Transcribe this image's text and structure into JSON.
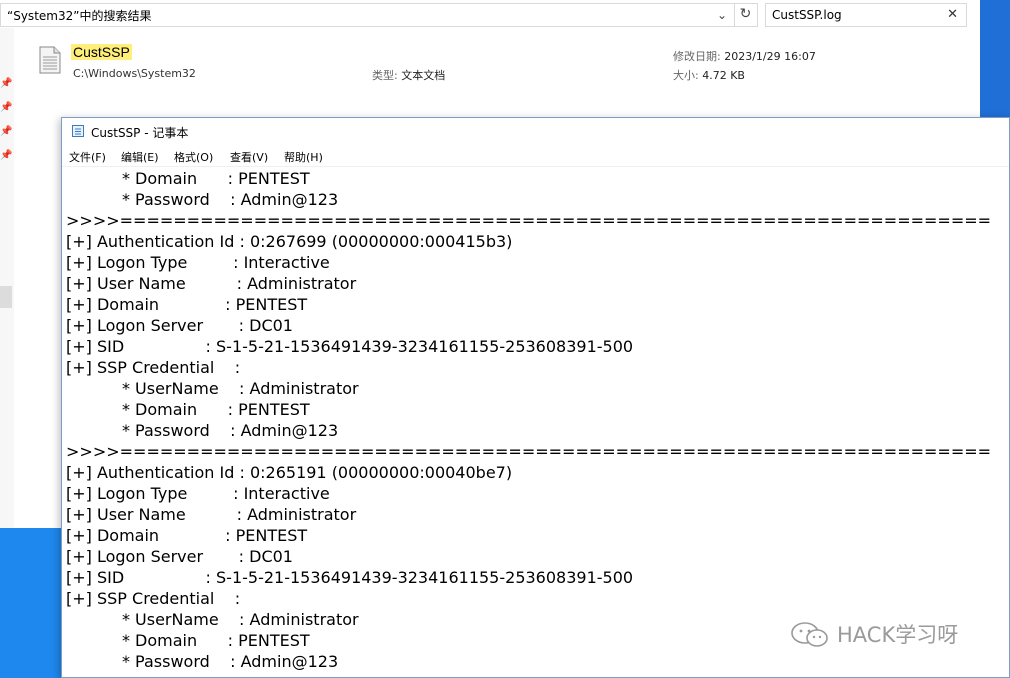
{
  "explorer": {
    "address_text": "“System32”中的搜索结果",
    "search_text": "CustSSP.log",
    "result": {
      "name": "CustSSP",
      "path": "C:\\Windows\\System32",
      "type_label": "类型:",
      "type_value": "文本文档",
      "date_label": "修改日期:",
      "date_value": "2023/1/29 16:07",
      "size_label": "大小:",
      "size_value": "4.72 KB"
    }
  },
  "notepad": {
    "title": "CustSSP - 记事本",
    "menu": [
      "文件(F)",
      "编辑(E)",
      "格式(O)",
      "查看(V)",
      "帮助(H)"
    ],
    "lines": [
      "           * Domain      : PENTEST",
      "           * Password    : Admin@123",
      ">>>>=================================================================",
      "[+] Authentication Id : 0:267699 (00000000:000415b3)",
      "[+] Logon Type         : Interactive",
      "[+] User Name          : Administrator",
      "[+] Domain             : PENTEST",
      "[+] Logon Server       : DC01",
      "[+] SID                : S-1-5-21-1536491439-3234161155-253608391-500",
      "[+] SSP Credential    :",
      "           * UserName    : Administrator",
      "           * Domain      : PENTEST",
      "           * Password    : Admin@123",
      ">>>>=================================================================",
      "[+] Authentication Id : 0:265191 (00000000:00040be7)",
      "[+] Logon Type         : Interactive",
      "[+] User Name          : Administrator",
      "[+] Domain             : PENTEST",
      "[+] Logon Server       : DC01",
      "[+] SID                : S-1-5-21-1536491439-3234161155-253608391-500",
      "[+] SSP Credential    :",
      "           * UserName    : Administrator",
      "           * Domain      : PENTEST",
      "           * Password    : Admin@123"
    ]
  },
  "watermark": {
    "text": "HACK学习呀"
  },
  "colors": {
    "desktop": "#1f6fd6",
    "highlight": "#ffef7a"
  }
}
